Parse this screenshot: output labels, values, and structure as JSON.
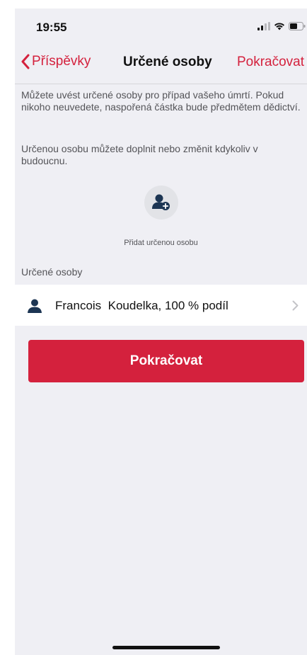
{
  "status_bar": {
    "time": "19:55",
    "icons": [
      "signal-icon",
      "wifi-icon",
      "battery-icon"
    ]
  },
  "nav": {
    "back_label": "Příspěvky",
    "title": "Určené osoby",
    "action_label": "Pokračovat"
  },
  "intro": {
    "paragraph1": "Můžete uvést určené osoby pro případ vašeho úmrtí. Pokud nikoho neuvedete, naspořená částka bude předmětem dědictví.",
    "paragraph2": "Určenou osobu můžete doplnit nebo změnit kdykoliv v budoucnu."
  },
  "add_person": {
    "label": "Přidat určenou osobu"
  },
  "section": {
    "label": "Určené osoby"
  },
  "persons": [
    {
      "text": "Francois  Koudelka, 100 % podíl"
    }
  ],
  "primary_button": {
    "label": "Pokračovat"
  },
  "colors": {
    "accent": "#d4213d",
    "background": "#efeff4",
    "icon_dark": "#1c3553"
  }
}
